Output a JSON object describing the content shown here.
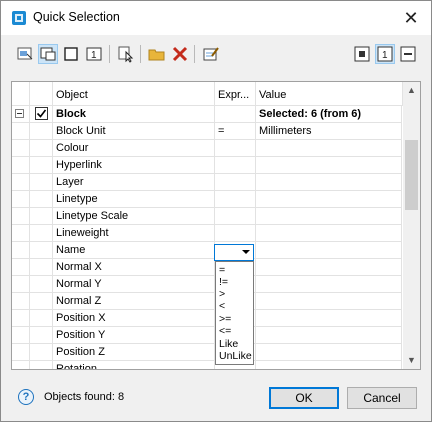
{
  "window": {
    "title": "Quick Selection",
    "app_icon": "quick-select-app-icon",
    "close_icon": "close-icon"
  },
  "toolbar": {
    "left_buttons": [
      "select-objects-icon",
      "select-from-set-icon",
      "new-selection-icon",
      "single-object-icon",
      "pick-object-icon",
      "open-filter-icon",
      "delete-icon",
      "edit-properties-icon"
    ],
    "right_buttons": [
      "include-icon",
      "single-mode-icon",
      "exclude-icon"
    ]
  },
  "table": {
    "headers": [
      "Object",
      "Expr...",
      "Value"
    ],
    "group": {
      "name": "Block",
      "value": "Selected: 6 (from 6)",
      "checked": true
    },
    "rows": [
      {
        "object": "Block Unit",
        "expr": "=",
        "value": "Millimeters"
      },
      {
        "object": "Colour",
        "expr": "",
        "value": ""
      },
      {
        "object": "Hyperlink",
        "expr": "",
        "value": ""
      },
      {
        "object": "Layer",
        "expr": "",
        "value": ""
      },
      {
        "object": "Linetype",
        "expr": "",
        "value": ""
      },
      {
        "object": "Linetype Scale",
        "expr": "",
        "value": ""
      },
      {
        "object": "Lineweight",
        "expr": "",
        "value": ""
      },
      {
        "object": "Name",
        "expr": "",
        "value": ""
      },
      {
        "object": "Normal X",
        "expr": "",
        "value": ""
      },
      {
        "object": "Normal Y",
        "expr": "",
        "value": ""
      },
      {
        "object": "Normal Z",
        "expr": "",
        "value": ""
      },
      {
        "object": "Position X",
        "expr": "",
        "value": ""
      },
      {
        "object": "Position Y",
        "expr": "",
        "value": ""
      },
      {
        "object": "Position Z",
        "expr": "",
        "value": ""
      },
      {
        "object": "Rotation",
        "expr": "",
        "value": ""
      }
    ]
  },
  "operator_dropdown": {
    "options": [
      "=",
      "!=",
      ">",
      "<",
      ">=",
      "<=",
      "Like",
      "UnLike"
    ]
  },
  "footer": {
    "help_icon": "help-icon",
    "status": "Objects found: 8",
    "ok_label": "OK",
    "cancel_label": "Cancel"
  },
  "colors": {
    "accent": "#0078d7",
    "close_red": "#c42b1c",
    "folder": "#e8b53a"
  }
}
